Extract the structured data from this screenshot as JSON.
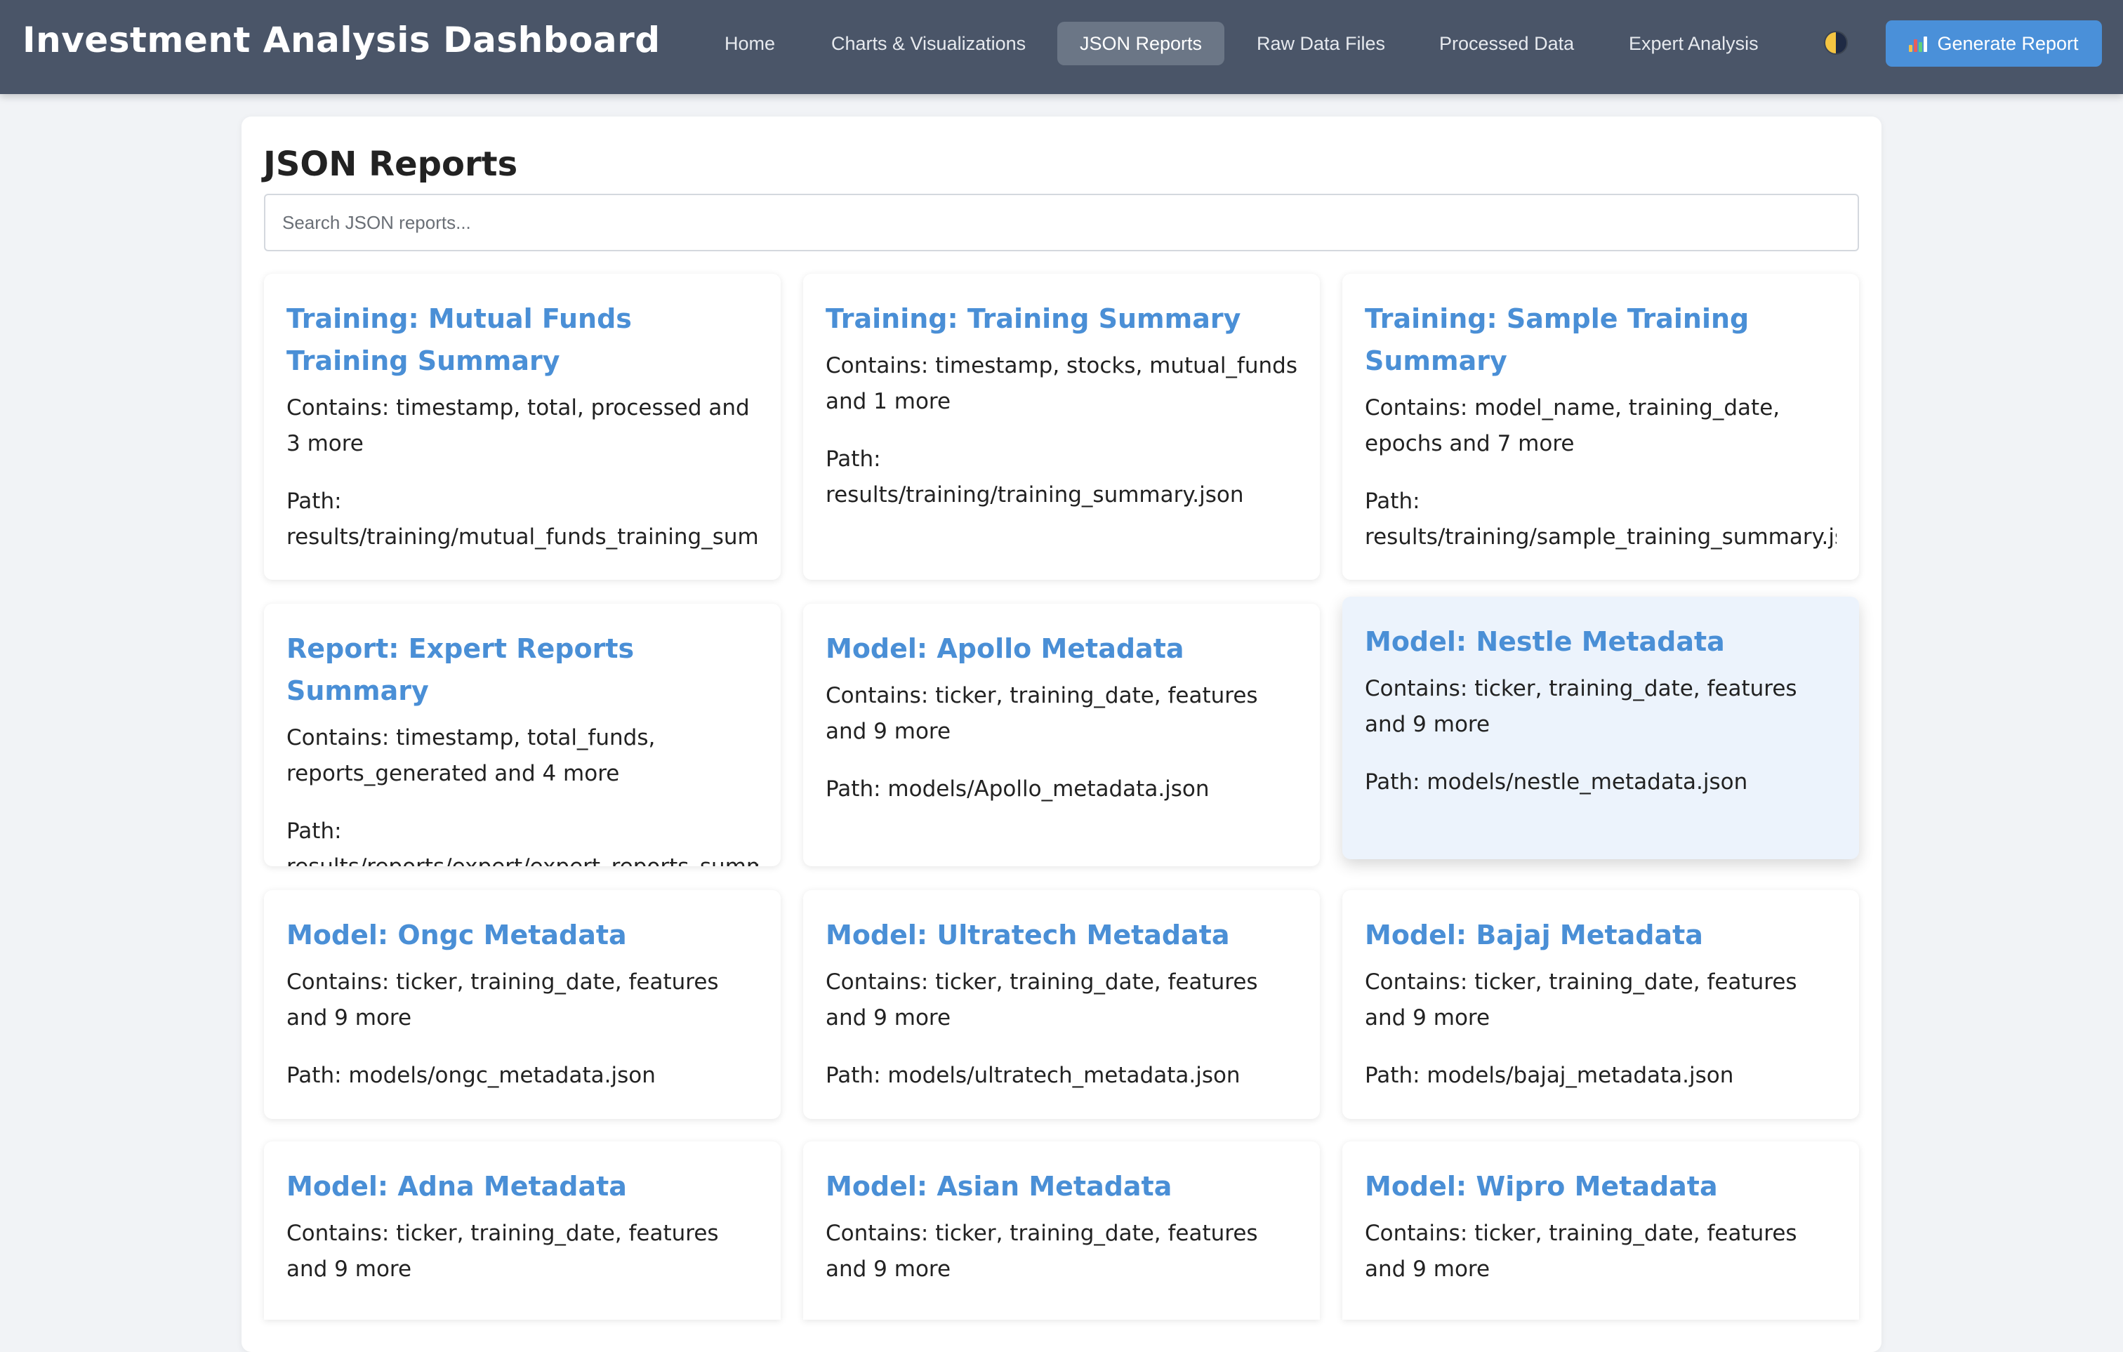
{
  "header": {
    "title": "Investment Analysis Dashboard",
    "nav": [
      {
        "label": "Home",
        "active": false
      },
      {
        "label": "Charts & Visualizations",
        "active": false
      },
      {
        "label": "JSON Reports",
        "active": true
      },
      {
        "label": "Raw Data Files",
        "active": false
      },
      {
        "label": "Processed Data",
        "active": false
      },
      {
        "label": "Expert Analysis",
        "active": false
      }
    ],
    "theme_toggle_icon": "half-moon-icon",
    "generate_button": {
      "icon": "chart-icon",
      "label": "Generate Report"
    }
  },
  "main": {
    "title": "JSON Reports",
    "search": {
      "placeholder": "Search JSON reports...",
      "value": ""
    },
    "cards": [
      {
        "title": "Training: Mutual Funds Training Summary",
        "contains": "Contains: timestamp, total, processed and 3 more",
        "path_label": "Path:",
        "path": "results/training/mutual_funds_training_summary.j"
      },
      {
        "title": "Training: Training Summary",
        "contains": "Contains: timestamp, stocks, mutual_funds and 1 more",
        "path_label": "Path:",
        "path": "results/training/training_summary.json"
      },
      {
        "title": "Training: Sample Training Summary",
        "contains": "Contains: model_name, training_date, epochs and 7 more",
        "path_label": "Path:",
        "path": "results/training/sample_training_summary.json"
      },
      {
        "title": "Report: Expert Reports Summary",
        "contains": "Contains: timestamp, total_funds, reports_generated and 4 more",
        "path_label": "Path:",
        "path": "results/reports/expert/expert_reports_summary.js"
      },
      {
        "title": "Model: Apollo Metadata",
        "contains": "Contains: ticker, training_date, features and 9 more",
        "path_label": "Path:",
        "path": "models/Apollo_metadata.json"
      },
      {
        "title": "Model: Nestle Metadata",
        "contains": "Contains: ticker, training_date, features and 9 more",
        "path_label": "Path:",
        "path": "models/nestle_metadata.json"
      },
      {
        "title": "Model: Ongc Metadata",
        "contains": "Contains: ticker, training_date, features and 9 more",
        "path_label": "Path:",
        "path": "models/ongc_metadata.json"
      },
      {
        "title": "Model: Ultratech Metadata",
        "contains": "Contains: ticker, training_date, features and 9 more",
        "path_label": "Path:",
        "path": "models/ultratech_metadata.json"
      },
      {
        "title": "Model: Bajaj Metadata",
        "contains": "Contains: ticker, training_date, features and 9 more",
        "path_label": "Path:",
        "path": "models/bajaj_metadata.json"
      },
      {
        "title": "Model: Adna Metadata",
        "contains": "Contains: ticker, training_date, features and 9 more",
        "path_label": "",
        "path": ""
      },
      {
        "title": "Model: Asian Metadata",
        "contains": "Contains: ticker, training_date, features and 9 more",
        "path_label": "",
        "path": ""
      },
      {
        "title": "Model: Wipro Metadata",
        "contains": "Contains: ticker, training_date, features and 9 more",
        "path_label": "",
        "path": ""
      }
    ]
  },
  "colors": {
    "header_bg": "#4a5568",
    "active_nav_bg": "#6b7686",
    "accent": "#4a90d9",
    "card_title": "#4a8fd6",
    "page_bg": "#f1f3f6",
    "hover_card_bg": "#ecf3fc"
  }
}
